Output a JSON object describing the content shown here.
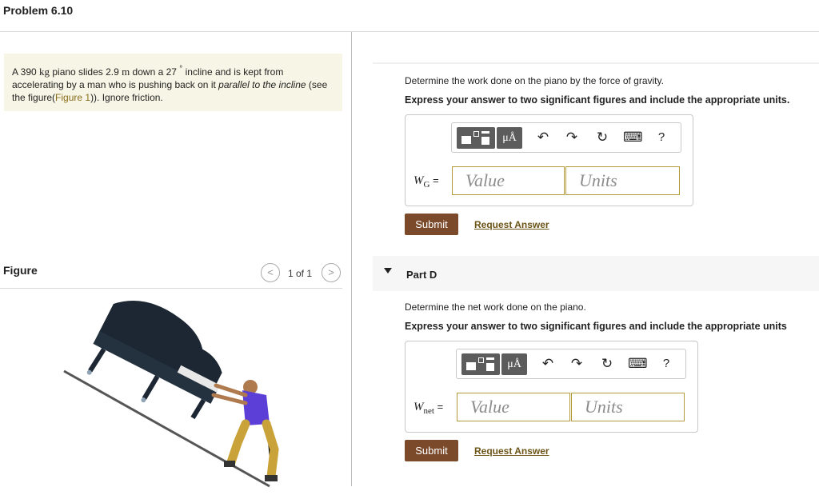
{
  "header": {
    "title": "Problem 6.10"
  },
  "problem": {
    "t1": "A 390 ",
    "u_kg": "kg",
    "t2": " piano slides 2.9 ",
    "u_m": "m",
    "t3": " down a 27 ",
    "u_deg": "°",
    "t4": " incline and is kept from accelerating by a man who is pushing back on it ",
    "italic": "parallel to the incline",
    "t5": " (see the figure(",
    "link": "Figure 1",
    "t6": ")). Ignore friction."
  },
  "figure": {
    "label": "Figure",
    "prev": "<",
    "count": "1 of 1",
    "next": ">"
  },
  "partC": {
    "question": "Determine the work done on the piano by the force of gravity.",
    "instruction": "Express your answer to two significant figures and include the appropriate units.",
    "toolbar": {
      "mu": "μÅ",
      "undo": "↶",
      "redo": "↷",
      "reset": "↻",
      "keyboard": "⌨",
      "help": "?"
    },
    "var": "W",
    "sub": "G",
    "eq": " =",
    "value_placeholder": "Value",
    "units_placeholder": "Units",
    "submit": "Submit",
    "request": "Request Answer"
  },
  "partD": {
    "label": "Part D",
    "question": "Determine the net work done on the piano.",
    "instruction": "Express your answer to two significant figures and include the appropriate units",
    "toolbar": {
      "mu": "μÅ",
      "undo": "↶",
      "redo": "↷",
      "reset": "↻",
      "keyboard": "⌨",
      "help": "?"
    },
    "var": "W",
    "sub": "net",
    "eq": " =",
    "value_placeholder": "Value",
    "units_placeholder": "Units",
    "submit": "Submit",
    "request": "Request Answer"
  },
  "colors": {
    "accent": "#7a4a2b",
    "problem_bg": "#f7f6e6",
    "field_border": "#b39b3a",
    "link": "#6b5416"
  }
}
